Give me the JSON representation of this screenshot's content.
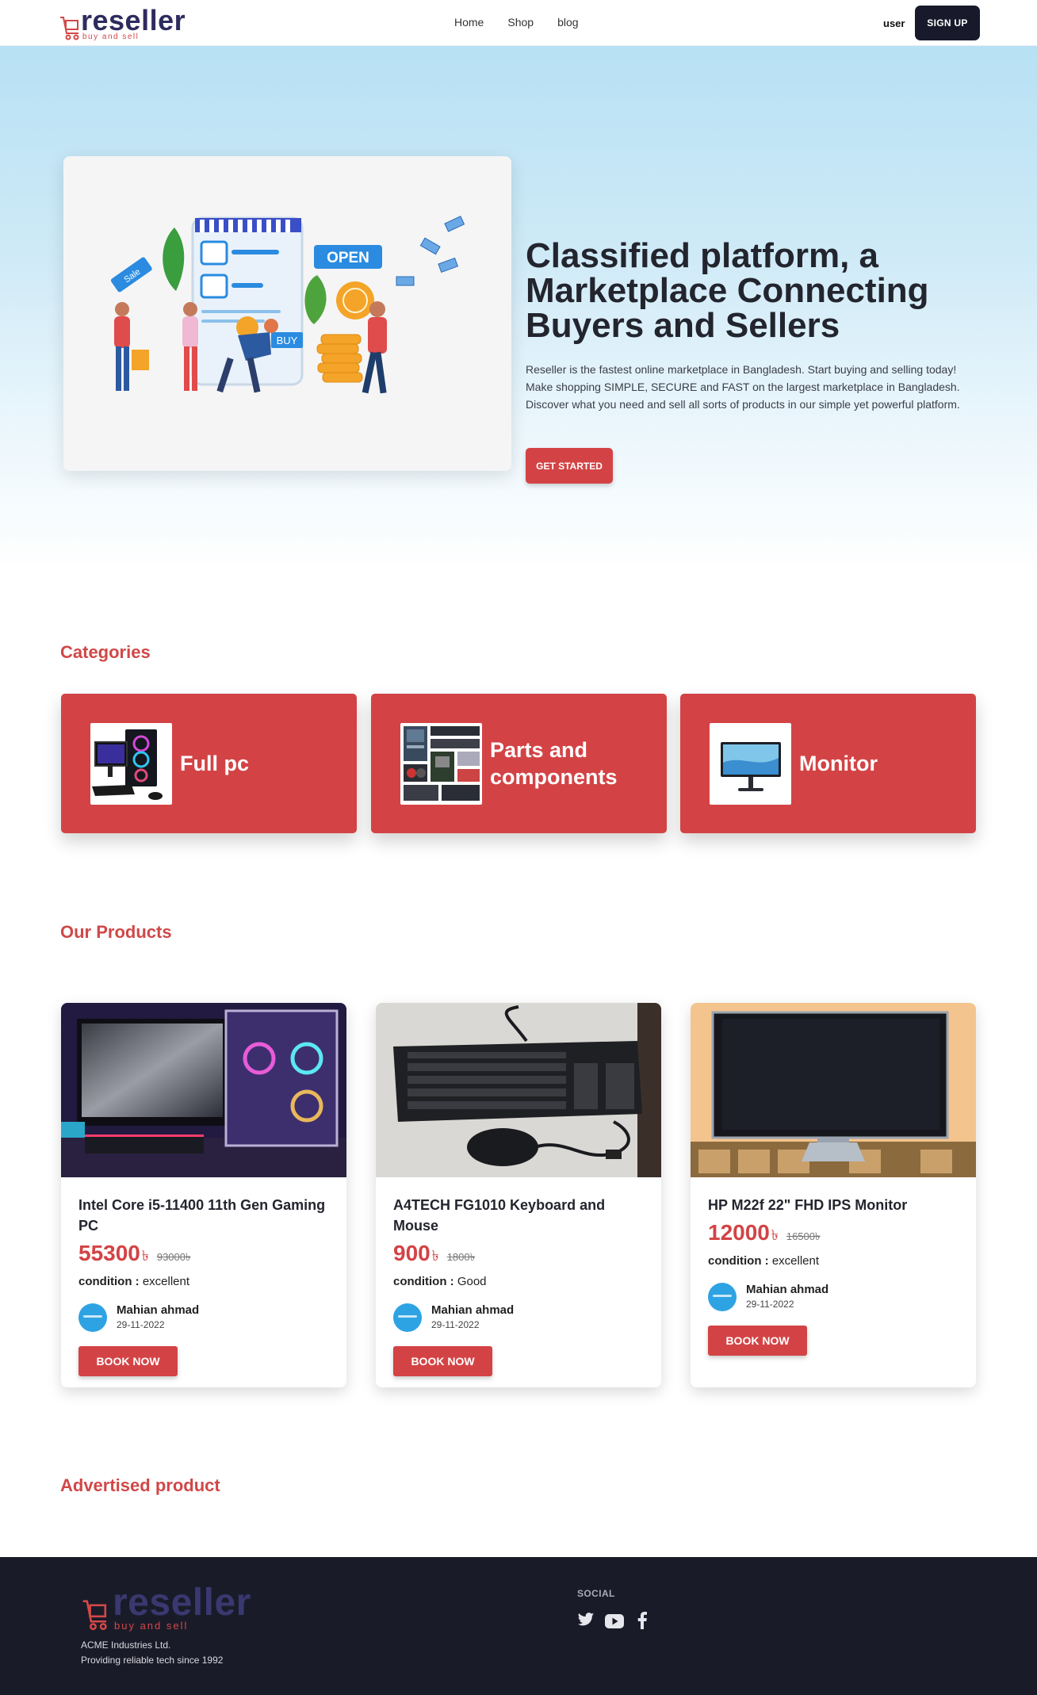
{
  "nav": {
    "logo_word": "reseller",
    "logo_tag": "buy and sell",
    "links": [
      "Home",
      "Shop",
      "blog"
    ],
    "user_label": "user",
    "signup_label": "SIGN UP"
  },
  "hero": {
    "title": "Classified platform, a Marketplace Connecting Buyers and Sellers",
    "description": "Reseller is the fastest online marketplace in Bangladesh. Start buying and selling today! Make shopping SIMPLE, SECURE and FAST on the largest marketplace in Bangladesh. Discover what you need and sell all sorts of products in our simple yet powerful platform.",
    "cta_label": "GET STARTED",
    "illustration_text": {
      "sale": "Sale",
      "open": "OPEN",
      "buy": "BUY"
    }
  },
  "categories": {
    "title": "Categories",
    "items": [
      {
        "label": "Full pc",
        "icon": "gaming-pc-icon"
      },
      {
        "label": "Parts and components",
        "icon": "pc-components-icon"
      },
      {
        "label": "Monitor",
        "icon": "monitor-icon"
      }
    ]
  },
  "products": {
    "title": "Our Products",
    "items": [
      {
        "name": "Intel Core i5-11400 11th Gen Gaming PC",
        "price": "55300",
        "currency": "৳",
        "old_price": "93000৳",
        "condition_label": "condition :",
        "condition": "excellent",
        "seller": "Mahian ahmad",
        "date": "29-11-2022",
        "book_label": "BOOK NOW"
      },
      {
        "name": "A4TECH FG1010 Keyboard and Mouse",
        "price": "900",
        "currency": "৳",
        "old_price": "1800৳",
        "condition_label": "condition :",
        "condition": "Good",
        "seller": "Mahian ahmad",
        "date": "29-11-2022",
        "book_label": "BOOK NOW"
      },
      {
        "name": "HP M22f 22\" FHD IPS Monitor",
        "price": "12000",
        "currency": "৳",
        "old_price": "16500৳",
        "condition_label": "condition :",
        "condition": "excellent",
        "seller": "Mahian ahmad",
        "date": "29-11-2022",
        "book_label": "BOOK NOW"
      }
    ]
  },
  "advertised": {
    "title": "Advertised product"
  },
  "footer": {
    "logo_word": "reseller",
    "logo_tag": "buy and sell",
    "company": "ACME Industries Ltd.",
    "tagline": "Providing reliable tech since 1992",
    "social_title": "SOCIAL",
    "social_icons": [
      "twitter-icon",
      "youtube-icon",
      "facebook-icon"
    ]
  },
  "colors": {
    "accent": "#d34345",
    "dark": "#181a2b",
    "brand": "#2e2b5f",
    "footer_bg": "#1a1b28"
  }
}
